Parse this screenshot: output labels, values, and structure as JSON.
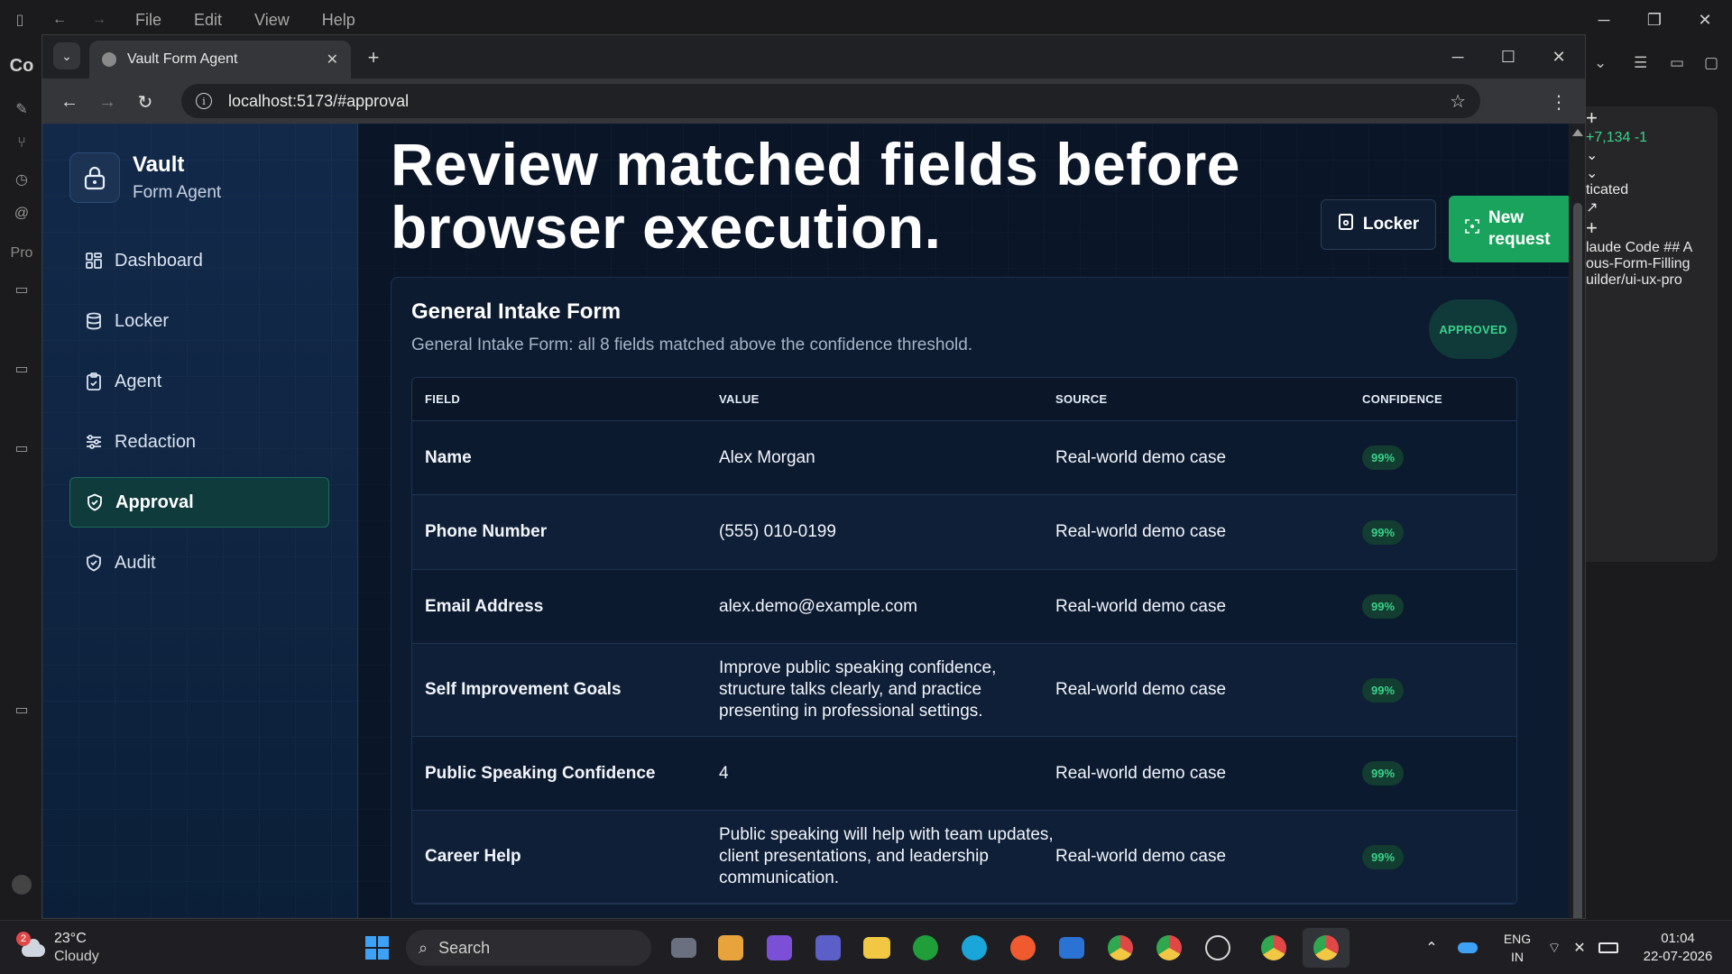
{
  "host": {
    "menus": [
      "File",
      "Edit",
      "View",
      "Help"
    ],
    "left_labels": [
      "Co",
      "Pro"
    ],
    "right_items": [
      "+7,134 -1",
      "ticated",
      "laude Code ## A",
      "ous-Form-Filling",
      "uilder/ui-ux-pro"
    ]
  },
  "browser": {
    "tab_title": "Vault Form Agent",
    "url": "localhost:5173/#approval"
  },
  "app": {
    "brand_name": "Vault",
    "brand_sub": "Form Agent",
    "nav": [
      {
        "label": "Dashboard",
        "icon": "dashboard-icon"
      },
      {
        "label": "Locker",
        "icon": "database-icon"
      },
      {
        "label": "Agent",
        "icon": "clipboard-icon"
      },
      {
        "label": "Redaction",
        "icon": "sliders-icon"
      },
      {
        "label": "Approval",
        "icon": "shield-check-icon",
        "active": true
      },
      {
        "label": "Audit",
        "icon": "shield-check-icon"
      }
    ],
    "page_title": "Review matched fields before browser execution.",
    "locker_button": "Locker",
    "new_request_button": "New request",
    "form": {
      "title": "General Intake Form",
      "description": "General Intake Form: all 8 fields matched above the confidence threshold.",
      "status": "APPROVED",
      "columns": [
        "FIELD",
        "VALUE",
        "SOURCE",
        "CONFIDENCE"
      ],
      "rows": [
        {
          "field": "Name",
          "value": "Alex Morgan",
          "source": "Real-world demo case",
          "confidence": "99%"
        },
        {
          "field": "Phone Number",
          "value": "(555) 010-0199",
          "source": "Real-world demo case",
          "confidence": "99%"
        },
        {
          "field": "Email Address",
          "value": "alex.demo@example.com",
          "source": "Real-world demo case",
          "confidence": "99%"
        },
        {
          "field": "Self Improvement Goals",
          "value": "Improve public speaking confidence, structure talks clearly, and practice presenting in professional settings.",
          "source": "Real-world demo case",
          "confidence": "99%"
        },
        {
          "field": "Public Speaking Confidence",
          "value": "4",
          "source": "Real-world demo case",
          "confidence": "99%"
        },
        {
          "field": "Career Help",
          "value": "Public speaking will help with team updates, client presentations, and leadership communication.",
          "source": "Real-world demo case",
          "confidence": "99%"
        }
      ]
    }
  },
  "taskbar": {
    "weather_temp": "23°C",
    "weather_cond": "Cloudy",
    "weather_badge": "2",
    "search_label": "Search",
    "lang_1": "ENG",
    "lang_2": "IN",
    "time": "01:04",
    "date": "22-07-2026"
  },
  "colors": {
    "accent_green": "#1aa35d",
    "status_green": "#3ad38a",
    "sidebar_bg": "#13294a",
    "main_bg": "#0a1628"
  }
}
